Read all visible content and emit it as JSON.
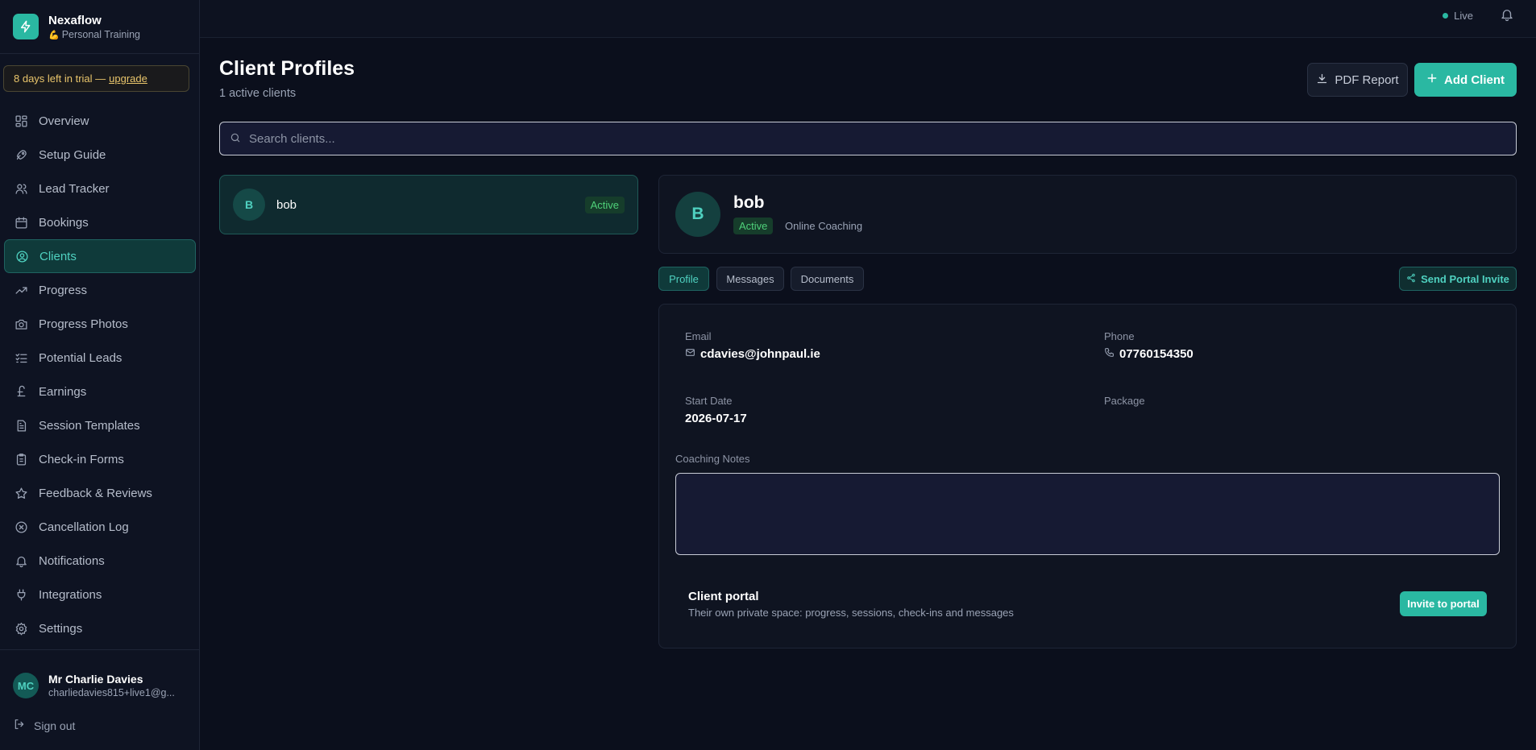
{
  "brand": {
    "name": "Nexaflow",
    "subtitle": "Personal Training",
    "subtitle_emoji": "💪"
  },
  "trial": {
    "text": "8 days left in trial —",
    "link": "upgrade"
  },
  "nav": {
    "items": [
      {
        "label": "Overview",
        "icon": "grid-icon"
      },
      {
        "label": "Setup Guide",
        "icon": "rocket-icon"
      },
      {
        "label": "Lead Tracker",
        "icon": "users-icon"
      },
      {
        "label": "Bookings",
        "icon": "calendar-icon"
      },
      {
        "label": "Clients",
        "icon": "user-circle-icon",
        "active": true
      },
      {
        "label": "Progress",
        "icon": "trending-up-icon"
      },
      {
        "label": "Progress Photos",
        "icon": "camera-icon"
      },
      {
        "label": "Potential Leads",
        "icon": "list-check-icon"
      },
      {
        "label": "Earnings",
        "icon": "pound-icon"
      },
      {
        "label": "Session Templates",
        "icon": "file-text-icon"
      },
      {
        "label": "Check-in Forms",
        "icon": "clipboard-icon"
      },
      {
        "label": "Feedback & Reviews",
        "icon": "star-icon"
      },
      {
        "label": "Cancellation Log",
        "icon": "x-circle-icon"
      },
      {
        "label": "Notifications",
        "icon": "bell-icon"
      },
      {
        "label": "Integrations",
        "icon": "plug-icon"
      },
      {
        "label": "Settings",
        "icon": "gear-icon"
      }
    ]
  },
  "user": {
    "initials": "MC",
    "name": "Mr Charlie Davies",
    "email": "charliedavies815+live1@g..."
  },
  "signout_label": "Sign out",
  "topbar": {
    "status": "Live"
  },
  "header": {
    "title": "Client Profiles",
    "subtitle": "1 active clients",
    "pdf_label": "PDF Report",
    "add_label": "Add Client"
  },
  "search": {
    "placeholder": "Search clients...",
    "value": ""
  },
  "clients": [
    {
      "initial": "B",
      "name": "bob",
      "status": "Active"
    }
  ],
  "detail": {
    "initial": "B",
    "name": "bob",
    "status": "Active",
    "package_type": "Online Coaching",
    "tabs": [
      "Profile",
      "Messages",
      "Documents"
    ],
    "active_tab": "Profile",
    "send_invite_label": "Send Portal Invite",
    "fields": {
      "email_label": "Email",
      "email": "cdavies@johnpaul.ie",
      "phone_label": "Phone",
      "phone": "07760154350",
      "start_label": "Start Date",
      "start": "2026-07-17",
      "package_label": "Package",
      "package": ""
    },
    "notes_label": "Coaching Notes",
    "notes": "",
    "portal": {
      "title": "Client portal",
      "description": "Their own private space: progress, sessions, check-ins and messages",
      "button": "Invite to portal"
    }
  },
  "colors": {
    "accent": "#2ab8a2",
    "background": "#0b0f1c",
    "warning": "#e9c56b",
    "success": "#4fd17a"
  }
}
